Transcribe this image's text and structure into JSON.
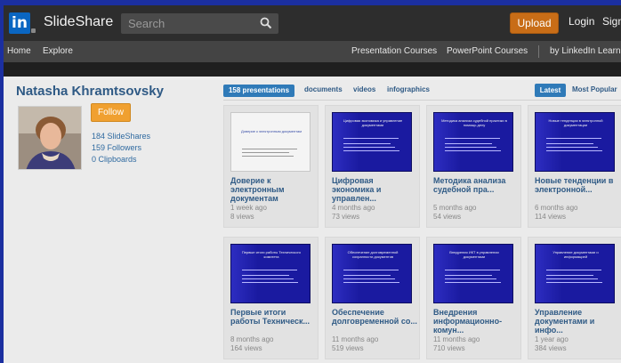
{
  "header": {
    "logo_mark": "in",
    "logo_text": "SlideShare",
    "search_placeholder": "Search",
    "upload_label": "Upload",
    "login_label": "Login",
    "signup_label": "Sign up",
    "brand_color": "#0a66c2",
    "upload_color": "#c86d17"
  },
  "nav": {
    "items": [
      "Home",
      "Explore"
    ],
    "right_items": [
      "Presentation Courses",
      "PowerPoint Courses",
      "by LinkedIn Learning"
    ]
  },
  "profile": {
    "name": "Natasha Khramtsovsky",
    "follow_label": "Follow",
    "stats": [
      "184 SlideShares",
      "159 Followers",
      "0 Clipboards"
    ]
  },
  "tabs": {
    "active": "158 presentations",
    "items": [
      "documents",
      "videos",
      "infographics"
    ],
    "sort_active": "Latest",
    "sort_other": "Most Popular"
  },
  "cards": [
    {
      "title": "Доверие к электронным документам",
      "age": "1 week ago",
      "views": "8 views",
      "thumb_text": "Доверие к электронным документам"
    },
    {
      "title": "Цифровая экономика и управлен...",
      "age": "4 months ago",
      "views": "73 views",
      "thumb_text": "Цифровая экономика и управление документами"
    },
    {
      "title": "Методика анализа судебной пра...",
      "age": "5 months ago",
      "views": "54 views",
      "thumb_text": "Методика анализа судебной практики в помощь делу"
    },
    {
      "title": "Новые тенденции в электронной...",
      "age": "6 months ago",
      "views": "114 views",
      "thumb_text": "Новые тенденции в электронной документации"
    },
    {
      "title": "Первые итоги работы Техническ...",
      "age": "8 months ago",
      "views": "164 views",
      "thumb_text": "Первые итоги работы Технического комитета"
    },
    {
      "title": "Обеспечение долговременной со...",
      "age": "11 months ago",
      "views": "519 views",
      "thumb_text": "Обеспечение долговременной сохранности документов"
    },
    {
      "title": "Внедрения информационно-комун...",
      "age": "11 months ago",
      "views": "710 views",
      "thumb_text": "Внедрения ИКТ в управлении документами"
    },
    {
      "title": "Управление документами и инфо...",
      "age": "1 year ago",
      "views": "384 views",
      "thumb_text": "Управление документами и информацией"
    }
  ]
}
